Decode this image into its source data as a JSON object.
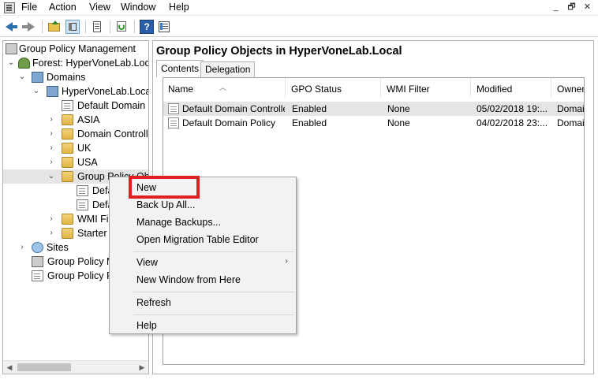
{
  "menubar": {
    "items": [
      "File",
      "Action",
      "View",
      "Window",
      "Help"
    ],
    "window_controls": [
      "_",
      "🗗",
      "✕"
    ]
  },
  "toolbar": {
    "icons": [
      "back-icon",
      "forward-icon",
      "up-folder-icon",
      "show-hide-tree-icon",
      "properties-icon",
      "refresh-icon",
      "help-icon",
      "export-list-icon"
    ]
  },
  "tree": {
    "root": "Group Policy Management",
    "forest": "Forest: HyperVoneLab.Local",
    "domains": "Domains",
    "domain": "HyperVoneLab.Local",
    "default_domain_policy": "Default Domain P",
    "asia": "ASIA",
    "domain_controllers": "Domain Controll",
    "uk": "UK",
    "usa": "USA",
    "gpo_container": "Group Policy Obj",
    "gpo_child_1": "Defa",
    "gpo_child_2": "Defa",
    "wmi_filters": "WMI Fil",
    "starter_gpos": "Starter G",
    "sites": "Sites",
    "gp_modeling": "Group Policy M",
    "gp_results": "Group Policy R"
  },
  "main": {
    "title": "Group Policy Objects in HyperVoneLab.Local",
    "tabs": [
      "Contents",
      "Delegation"
    ],
    "columns": [
      "Name",
      "GPO Status",
      "WMI Filter",
      "Modified",
      "Owner"
    ],
    "rows": [
      {
        "name": "Default Domain Controller...",
        "status": "Enabled",
        "wmi": "None",
        "modified": "05/02/2018 19:...",
        "owner": "Domai"
      },
      {
        "name": "Default Domain Policy",
        "status": "Enabled",
        "wmi": "None",
        "modified": "04/02/2018 23:...",
        "owner": "Domai"
      }
    ]
  },
  "context_menu": {
    "new": "New",
    "backup_all": "Back Up All...",
    "manage_backups": "Manage Backups...",
    "open_migration": "Open Migration Table Editor",
    "view": "View",
    "new_window": "New Window from Here",
    "refresh": "Refresh",
    "help": "Help"
  },
  "colors": {
    "highlight_box": "#e02020",
    "selected_row": "#e5e5e5",
    "menu_bg": "#f2f2f2"
  }
}
